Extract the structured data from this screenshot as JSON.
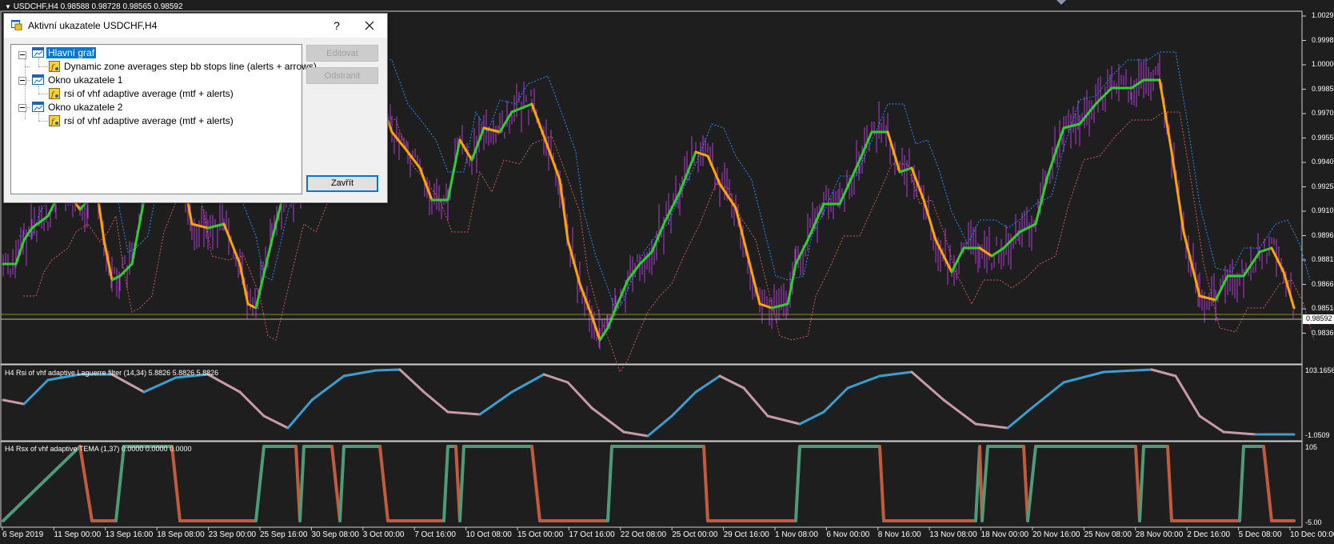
{
  "chart": {
    "symbol_header": "USDCHF,H4  0.98588 0.98728 0.98565 0.98592",
    "current_price": "0.98592",
    "price_axis": [
      "1.00295",
      "0.99985",
      "1.00000",
      "0.99850",
      "0.99705",
      "0.99555",
      "0.99405",
      "0.99255",
      "0.99105",
      "0.98960",
      "0.98810",
      "0.98660",
      "0.98510",
      "0.98360"
    ],
    "time_axis": [
      "6 Sep 2019",
      "11 Sep 00:00",
      "13 Sep 16:00",
      "18 Sep 08:00",
      "23 Sep 00:00",
      "25 Sep 16:00",
      "30 Sep 08:00",
      "3 Oct 00:00",
      "7 Oct 16:00",
      "10 Oct 08:00",
      "15 Oct 00:00",
      "17 Oct 16:00",
      "22 Oct 08:00",
      "25 Oct 00:00",
      "29 Oct 16:00",
      "1 Nov 08:00",
      "6 Nov 00:00",
      "8 Nov 16:00",
      "13 Nov 08:00",
      "18 Nov 00:00",
      "20 Nov 16:00",
      "25 Nov 08:00",
      "28 Nov 00:00",
      "2 Dec 16:00",
      "5 Dec 08:00",
      "10 Dec 00:00"
    ],
    "sub1_label": "H4 Rsi of vhf adaptive Laguerre filter (14,34) 5.8826 5.8826 5.8826",
    "sub1_axis": [
      "103.1656",
      "-1.0509"
    ],
    "sub2_label": "H4 Rsx of vhf adaptive TEMA (1,37) 0.0000 0.0000 0.0000",
    "sub2_axis": [
      "105",
      "-5.00"
    ],
    "colors": {
      "background": "#1e1e1e",
      "candles": "#b23bd6",
      "line_up": "#32cd32",
      "line_down": "#ffa500",
      "band_upper": "#1e90ff",
      "band_lower": "#cd5c5c",
      "rsi_up": "#3a9fd0",
      "rsi_down": "#c89aa8",
      "rsx_up": "#4f9a78",
      "rsx_down": "#c45a3c"
    }
  },
  "dialog": {
    "title": "Aktivní ukazatele USDCHF,H4",
    "help": "?",
    "tree": {
      "main_label": "Hlavní graf",
      "main_indicator": "Dynamic zone averages step bb stops line (alerts + arrows)",
      "window1_label": "Okno ukazatele 1",
      "window1_indicator": "rsi of vhf adaptive average (mtf + alerts)",
      "window2_label": "Okno ukazatele 2",
      "window2_indicator": "rsi of vhf adaptive average (mtf + alerts)"
    },
    "buttons": {
      "edit": "Editovat",
      "remove": "Odstranit",
      "close": "Zavřít"
    }
  }
}
